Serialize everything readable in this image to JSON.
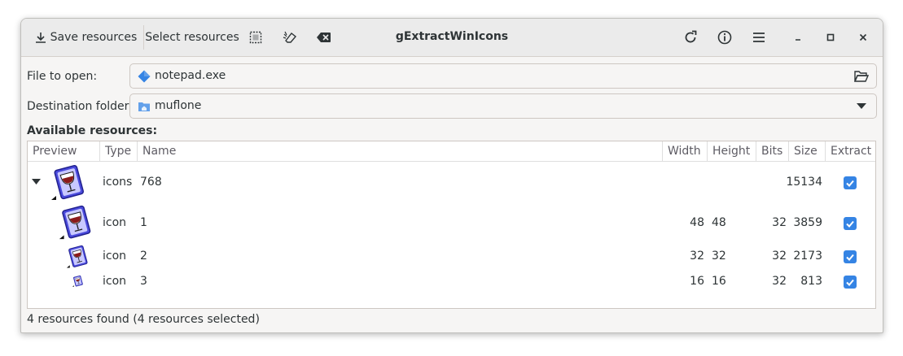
{
  "header": {
    "save_label": "Save resources",
    "select_label": "Select resources",
    "title": "gExtractWinIcons"
  },
  "form": {
    "file_label": "File to open:",
    "file_value": "notepad.exe",
    "dest_label": "Destination folder:",
    "dest_value": "muflone"
  },
  "resources_title": "Available resources:",
  "columns": {
    "preview": "Preview",
    "type": "Type",
    "name": "Name",
    "width": "Width",
    "height": "Height",
    "bits": "Bits",
    "size": "Size",
    "extract": "Extract"
  },
  "rows": [
    {
      "type": "icons",
      "name": "768",
      "width": "",
      "height": "",
      "bits": "",
      "size": "15134",
      "extract": true
    },
    {
      "type": "icon",
      "name": "1",
      "width": "48",
      "height": "48",
      "bits": "32",
      "size": "3859",
      "extract": true
    },
    {
      "type": "icon",
      "name": "2",
      "width": "32",
      "height": "32",
      "bits": "32",
      "size": "2173",
      "extract": true
    },
    {
      "type": "icon",
      "name": "3",
      "width": "16",
      "height": "16",
      "bits": "32",
      "size": "813",
      "extract": true
    }
  ],
  "status": "4 resources found (4 resources selected)",
  "colors": {
    "accent": "#3584e4",
    "icon_blue": "#4a4adc",
    "icon_wine": "#8b1a1a"
  }
}
